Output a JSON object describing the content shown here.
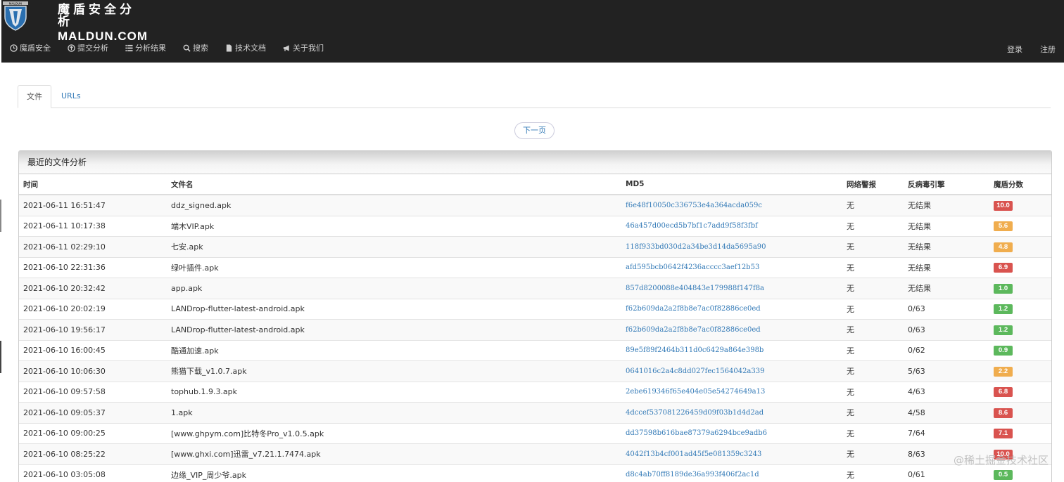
{
  "brand": {
    "cn": "魔盾安全分析",
    "en": "MALDUN.COM",
    "logo_text": "MALDUN"
  },
  "nav": {
    "items": [
      {
        "label": "魔盾安全",
        "icon": "clock-icon"
      },
      {
        "label": "提交分析",
        "icon": "upload-icon"
      },
      {
        "label": "分析结果",
        "icon": "list-icon"
      },
      {
        "label": "搜索",
        "icon": "search-icon"
      },
      {
        "label": "技术文档",
        "icon": "document-icon"
      },
      {
        "label": "关于我们",
        "icon": "megaphone-icon"
      }
    ],
    "login": "登录",
    "register": "注册"
  },
  "tabs": [
    {
      "label": "文件"
    },
    {
      "label": "URLs"
    }
  ],
  "pager": {
    "next": "下一页"
  },
  "panel": {
    "title": "最近的文件分析",
    "columns": [
      "时间",
      "文件名",
      "MD5",
      "网络警报",
      "反病毒引擎",
      "魔盾分数"
    ],
    "rows": [
      {
        "time": "2021-06-11 16:51:47",
        "name": "ddz_signed.apk",
        "md5": "f6e48f10050c336753e4a364acda059c",
        "alert": "无",
        "av": "无结果",
        "score": "10.0",
        "color": "#d9534f"
      },
      {
        "time": "2021-06-11 10:17:38",
        "name": "端木VIP.apk",
        "md5": "46a457d00ecd5b7bf1c7add9f58f3fbf",
        "alert": "无",
        "av": "无结果",
        "score": "5.6",
        "color": "#f0ad4e"
      },
      {
        "time": "2021-06-11 02:29:10",
        "name": "七安.apk",
        "md5": "118f933bd030d2a34be3d14da5695a90",
        "alert": "无",
        "av": "无结果",
        "score": "4.8",
        "color": "#f0ad4e"
      },
      {
        "time": "2021-06-10 22:31:36",
        "name": "绿叶插件.apk",
        "md5": "afd595bcb0642f4236acccc3aef12b53",
        "alert": "无",
        "av": "无结果",
        "score": "6.9",
        "color": "#d9534f"
      },
      {
        "time": "2021-06-10 20:32:42",
        "name": "app.apk",
        "md5": "857d8200088e404843e179988f147f8a",
        "alert": "无",
        "av": "无结果",
        "score": "1.0",
        "color": "#5cb85c"
      },
      {
        "time": "2021-06-10 20:02:19",
        "name": "LANDrop-flutter-latest-android.apk",
        "md5": "f62b609da2a2f8b8e7ac0f82886ce0ed",
        "alert": "无",
        "av": "0/63",
        "score": "1.2",
        "color": "#5cb85c"
      },
      {
        "time": "2021-06-10 19:56:17",
        "name": "LANDrop-flutter-latest-android.apk",
        "md5": "f62b609da2a2f8b8e7ac0f82886ce0ed",
        "alert": "无",
        "av": "0/63",
        "score": "1.2",
        "color": "#5cb85c"
      },
      {
        "time": "2021-06-10 16:00:45",
        "name": "酷通加速.apk",
        "md5": "89e5f89f2464b311d0c6429a864e398b",
        "alert": "无",
        "av": "0/62",
        "score": "0.9",
        "color": "#5cb85c"
      },
      {
        "time": "2021-06-10 10:06:30",
        "name": "熊猫下载_v1.0.7.apk",
        "md5": "0641016c2a4c8dd027fec1564042a339",
        "alert": "无",
        "av": "5/63",
        "score": "2.2",
        "color": "#f0ad4e"
      },
      {
        "time": "2021-06-10 09:57:58",
        "name": "tophub.1.9.3.apk",
        "md5": "2ebe619346f65e404e05e54274649a13",
        "alert": "无",
        "av": "4/63",
        "score": "6.8",
        "color": "#d9534f"
      },
      {
        "time": "2021-06-10 09:05:37",
        "name": "1.apk",
        "md5": "4dccef537081226459d09f03b1d4d2ad",
        "alert": "无",
        "av": "4/58",
        "score": "8.6",
        "color": "#d9534f"
      },
      {
        "time": "2021-06-10 09:00:25",
        "name": "[www.ghpym.com]比特冬Pro_v1.0.5.apk",
        "md5": "dd37598b616bae87379a6294bce9adb6",
        "alert": "无",
        "av": "7/64",
        "score": "7.1",
        "color": "#d9534f"
      },
      {
        "time": "2021-06-10 08:25:22",
        "name": "[www.ghxi.com]迅雷_v7.21.1.7474.apk",
        "md5": "4042f13b4cf001ad45f5e081359c3243",
        "alert": "无",
        "av": "8/63",
        "score": "10.0",
        "color": "#d9534f"
      },
      {
        "time": "2021-06-10 03:05:08",
        "name": "边缘_VIP_周少爷.apk",
        "md5": "d8c4ab70ff8189de36a993f406f2ac1d",
        "alert": "无",
        "av": "0/61",
        "score": "0.5",
        "color": "#5cb85c"
      }
    ]
  },
  "watermark": "@稀土掘金技术社区"
}
